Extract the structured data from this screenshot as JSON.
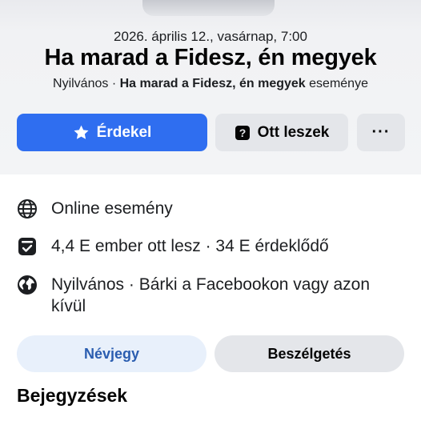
{
  "header": {
    "date": "2026. április 12., vasárnap, 7:00",
    "title": "Ha marad a Fidesz, én megyek",
    "privacy": "Nyilvános",
    "separator": " · ",
    "event_name": "Ha marad a Fidesz, én megyek",
    "event_suffix": " eseménye"
  },
  "actions": {
    "interested_label": "Érdekel",
    "interested_icon": "star-icon",
    "going_label": "Ott leszek",
    "going_icon": "question-mark-square-icon",
    "more_label": "···",
    "primary_color": "#2f6ef0"
  },
  "details": [
    {
      "icon": "globe-icon",
      "text": "Online esemény"
    },
    {
      "icon": "calendar-check-icon",
      "text": "4,4 E ember ott lesz · 34 E érdeklődő"
    },
    {
      "icon": "earth-filled-icon",
      "text": "Nyilvános · Bárki a Facebookon vagy azon kívül"
    }
  ],
  "tabs": [
    {
      "label": "Névjegy",
      "active": true
    },
    {
      "label": "Beszélgetés",
      "active": false
    }
  ],
  "section_title": "Bejegyzések"
}
